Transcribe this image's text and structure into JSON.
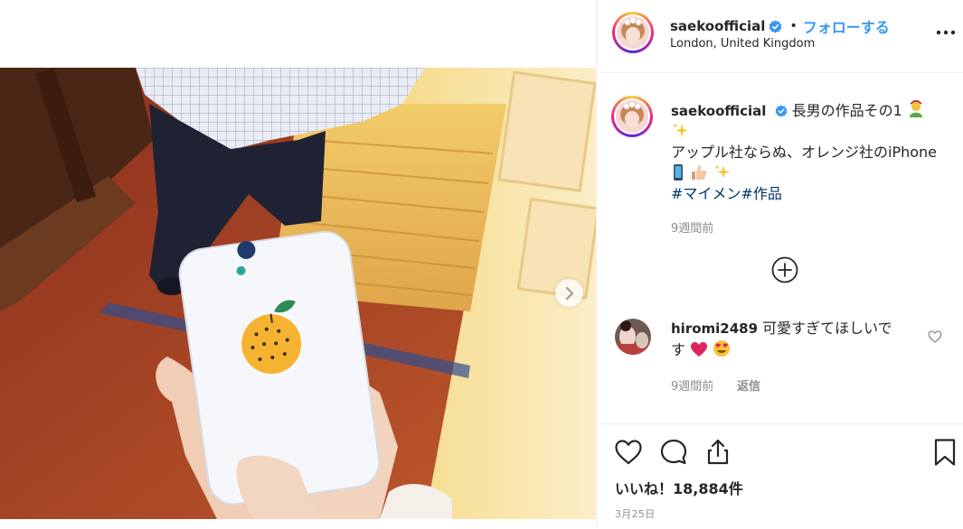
{
  "post": {
    "username": "saekoofficial",
    "verified": true,
    "separator": "•",
    "follow_label": "フォローする",
    "location": "London, United Kingdom",
    "more_icon": "more-options-icon",
    "next_icon": "chevron-right-icon"
  },
  "caption": {
    "username": "saekoofficial",
    "text_line1": "長男の作品その1",
    "text_line2": "アップル社ならぬ、オレンジ社のiPhone",
    "hashtags": "#マイメン#作品",
    "time": "9週間前",
    "emojis_line1": [
      "person-emoji",
      "sparkles-emoji"
    ],
    "emojis_line2": [
      "mobile-phone-emoji",
      "thumbs-up-emoji",
      "sparkles-emoji"
    ]
  },
  "load_more_icon": "plus-circle-icon",
  "comment": {
    "username": "hiromi2489",
    "text": "可愛すぎてほしいです",
    "emojis": [
      "red-heart-emoji",
      "heart-eyes-emoji"
    ],
    "time": "9週間前",
    "reply_label": "返信",
    "like_icon": "heart-outline-icon"
  },
  "actions": {
    "like_icon": "heart-outline-icon",
    "comment_icon": "comment-bubble-icon",
    "share_icon": "share-upload-icon",
    "save_icon": "bookmark-icon",
    "likes_text": "いいね！18,884件",
    "date": "3月25日"
  },
  "colors": {
    "link_blue": "#3897f0",
    "hashtag": "#003569",
    "muted": "#8e8e8e",
    "text": "#262626",
    "border": "#efefef"
  }
}
